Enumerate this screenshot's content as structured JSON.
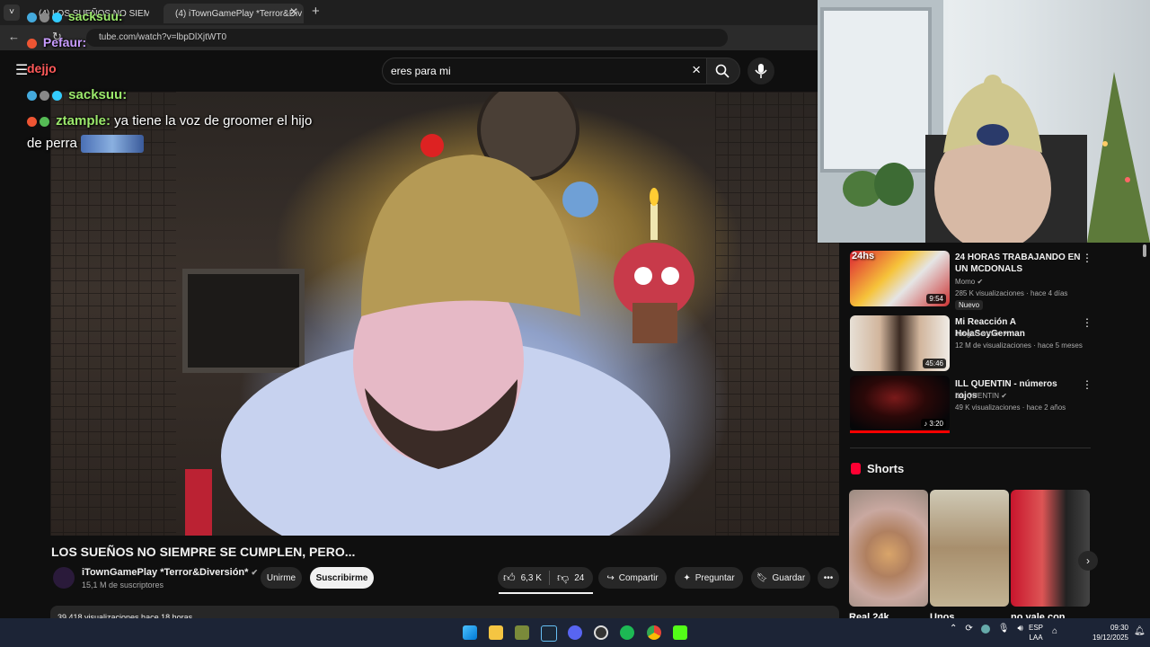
{
  "browser": {
    "tabs": [
      {
        "label": "(4) LOS SUEÑOS NO SIEMP",
        "active": false
      },
      {
        "label": "(4) iTownGamePlay *Terror&Div",
        "active": true
      }
    ],
    "url": "tube.com/watch?v=lbpDlXjtWT0"
  },
  "header": {
    "search_value": "eres para mi"
  },
  "chat": [
    {
      "user": "sacksuu:",
      "message": "",
      "color": "#9be86b"
    },
    {
      "user": "Pefaur:",
      "message": "",
      "color": "#c89cff"
    },
    {
      "user": "dejjo",
      "message": "",
      "color": "#ff5a5a"
    },
    {
      "user": "sacksuu:",
      "message": "",
      "color": "#9be86b"
    },
    {
      "user": "ztample:",
      "message": " ya tiene la voz de groomer el hijo",
      "color": "#9be86b"
    },
    {
      "user": "",
      "message": "de perra",
      "color": "#ffffff"
    }
  ],
  "video": {
    "title": "LOS SUEÑOS NO SIEMPRE SE CUMPLEN, PERO...",
    "channel": "iTownGamePlay *Terror&Diversión*",
    "subscribers": "15,1 M de suscriptores",
    "join_label": "Unirme",
    "subscribe_label": "Suscribirme",
    "likes": "6,3 K",
    "dislikes": "24",
    "share_label": "Compartir",
    "ask_label": "Preguntar",
    "save_label": "Guardar",
    "views": "39.418 visualizaciones  hace 18 horas"
  },
  "sidebar": {
    "videos": [
      {
        "title": "24 HORAS TRABAJANDO EN UN MCDONALS",
        "channel": "Momo",
        "meta": "285 K visualizaciones · hace 4 días",
        "badge": "Nuevo",
        "duration": "9:54",
        "overlay": "24hs"
      },
      {
        "title": "Mi Reacción A HolaSoyGerman",
        "channel": "JuegaGerman",
        "meta": "12 M de visualizaciones · hace 5 meses",
        "badge": "",
        "duration": "45:46",
        "overlay": ""
      },
      {
        "title": "ILL QUENTIN - números rojos",
        "channel": "ILL QUENTIN",
        "meta": "49 K visualizaciones · hace 2 años",
        "badge": "",
        "duration": "3:20",
        "overlay": ""
      }
    ],
    "shorts_heading": "Shorts",
    "shorts": [
      {
        "title": "Real 24k"
      },
      {
        "title": "Unos"
      },
      {
        "title": "no vale con"
      }
    ]
  },
  "tray": {
    "lang": "ESP",
    "lang2": "LAA",
    "time": "09:30",
    "date": "19/12/2025"
  }
}
